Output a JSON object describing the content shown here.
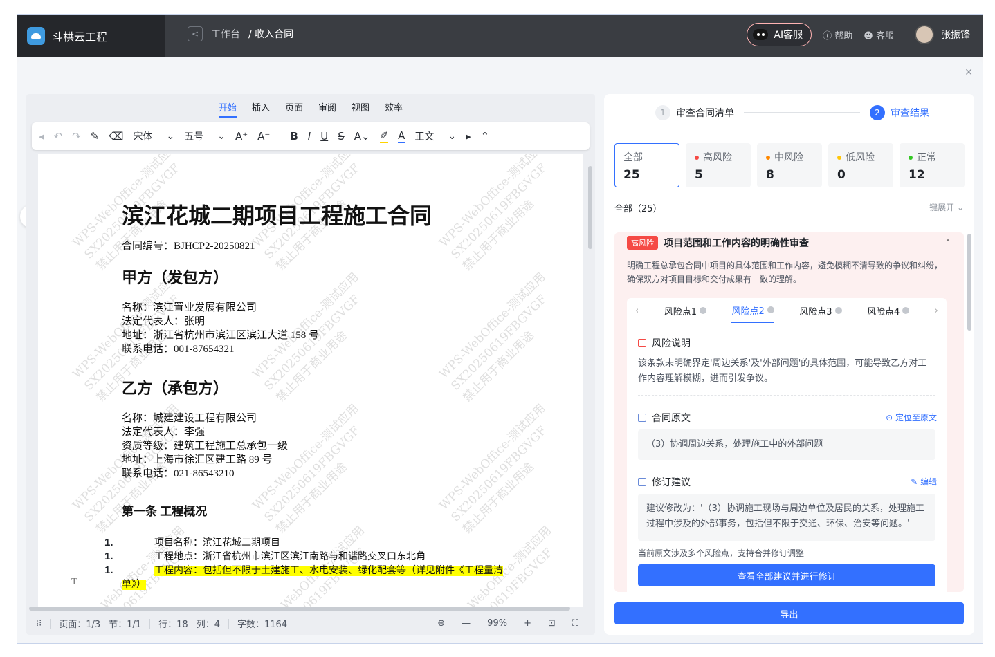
{
  "app": {
    "brand": "斗栱云工程",
    "breadcrumb_root": "工作台",
    "breadcrumb_current": "/ 收入合同"
  },
  "header": {
    "ai_label": "AI客服",
    "help": "帮助",
    "service": "客服",
    "user": "张振锋"
  },
  "doc_tabs": [
    "开始",
    "插入",
    "页面",
    "审阅",
    "视图",
    "效率"
  ],
  "toolbar": {
    "font": "宋体",
    "size": "五号",
    "style": "正文"
  },
  "document": {
    "title": "滨江花城二期项目工程施工合同",
    "contract_no": "合同编号：BJHCP2-20250821",
    "party_a_heading": "甲方（发包方）",
    "party_a": [
      "名称：滨江置业发展有限公司",
      "法定代表人：张明",
      "地址：浙江省杭州市滨江区滨江大道 158 号",
      "联系电话：001-87654321"
    ],
    "party_b_heading": "乙方（承包方）",
    "party_b": [
      "名称：城建建设工程有限公司",
      "法定代表人：李强",
      "资质等级：建筑工程施工总承包一级",
      "地址：上海市徐汇区建工路 89 号",
      "联系电话：021-86543210"
    ],
    "article1_heading": "第一条  工程概况",
    "list_marker": "1.",
    "items": [
      "项目名称：滨江花城二期项目",
      "工程地点：浙江省杭州市滨江区滨江南路与和谐路交叉口东北角",
      "工程内容：包括但不限于土建施工、水电安装、绿化配套等（详见附件《工程量清"
    ],
    "item3_cont": "单》）",
    "watermark": [
      "WPS-WebOffice-测试应用",
      "SX20250619FBGVGF",
      "禁止用于商业用途"
    ]
  },
  "statusbar": {
    "page": "页面：1/3",
    "section": "节：1/1",
    "line": "行：18",
    "col": "列：4",
    "words": "字数：1164",
    "zoom": "99%"
  },
  "panel": {
    "step1": "审查合同清单",
    "step2": "审查结果",
    "step1_num": "1",
    "step2_num": "2",
    "cards": [
      {
        "label": "全部",
        "count": "25",
        "color": ""
      },
      {
        "label": "高风险",
        "count": "5",
        "color": "#f54a45"
      },
      {
        "label": "中风险",
        "count": "8",
        "color": "#ff8800"
      },
      {
        "label": "低风险",
        "count": "0",
        "color": "#ffc60a"
      },
      {
        "label": "正常",
        "count": "12",
        "color": "#34c724"
      }
    ],
    "filter_title": "全部（25）",
    "expand_all": "一键展开",
    "risk": {
      "tag": "高风险",
      "title": "项目范围和工作内容的明确性审查",
      "desc": "明确工程总承包合同中项目的具体范围和工作内容，避免模糊不清导致的争议和纠纷，确保双方对项目目标和交付成果有一致的理解。",
      "tabs": [
        "风险点1",
        "风险点2",
        "风险点3",
        "风险点4"
      ],
      "explain_title": "风险说明",
      "explain": "该条款未明确界定'周边关系'及'外部问题'的具体范围，可能导致乙方对工作内容理解模糊，进而引发争议。",
      "original_title": "合同原文",
      "locate": "定位至原文",
      "original": "（3）协调周边关系，处理施工中的外部问题",
      "suggest_title": "修订建议",
      "edit": "编辑",
      "suggest": "建议修改为：'（3）协调施工现场与周边单位及居民的关系，处理施工过程中涉及的外部事务，包括但不限于交通、环保、治安等问题。'",
      "note": "当前原文涉及多个风险点，支持合并修订调整",
      "view_all": "查看全部建议并进行修订"
    },
    "export": "导出"
  }
}
